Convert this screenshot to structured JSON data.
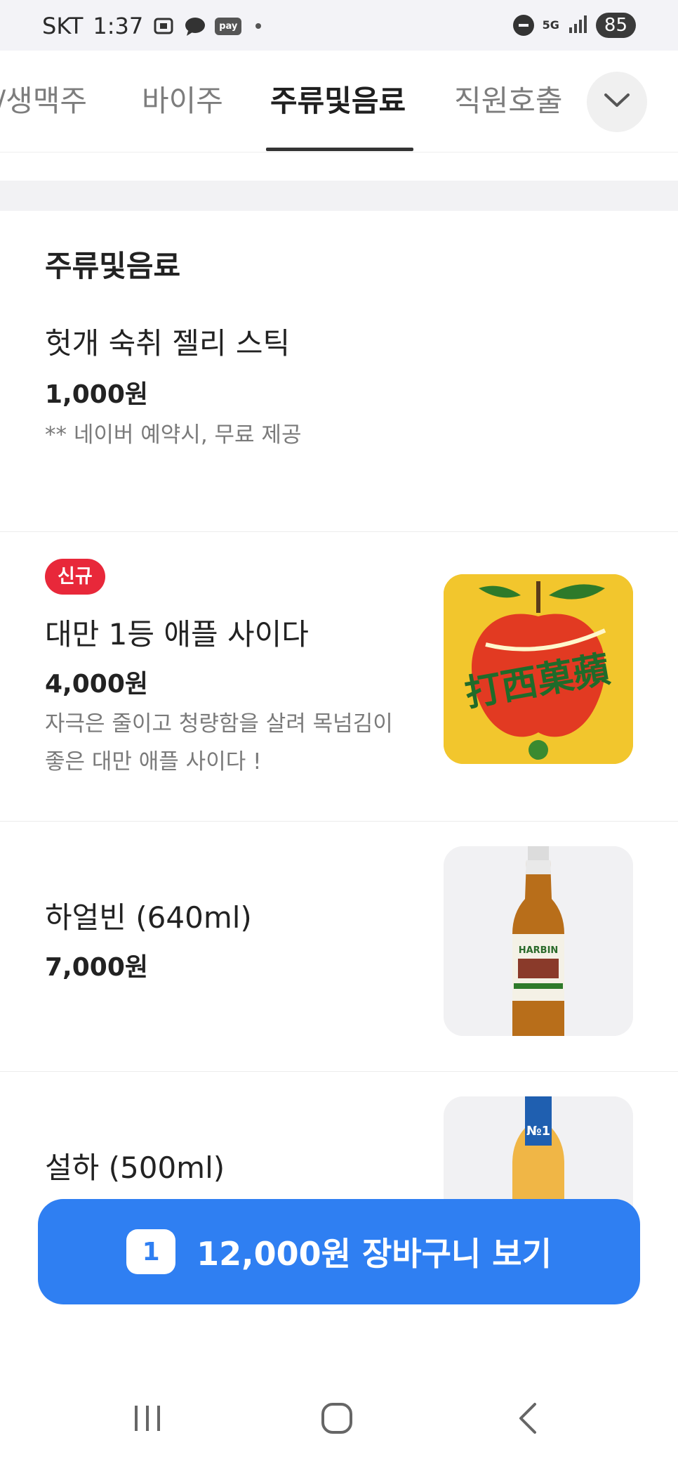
{
  "status_bar": {
    "carrier": "SKT",
    "time": "1:37",
    "pay_label": "pay",
    "network": "5G",
    "battery": "85"
  },
  "tabs": [
    {
      "label": "/생맥주",
      "active": false
    },
    {
      "label": "바이주",
      "active": false
    },
    {
      "label": "주류및음료",
      "active": true
    },
    {
      "label": "직원호출",
      "active": false
    }
  ],
  "section": {
    "title": "주류및음료"
  },
  "items": [
    {
      "name": "헛개 숙취 젤리 스틱",
      "price": "1,000원",
      "description": "** 네이버 예약시, 무료 제공"
    },
    {
      "badge": "신규",
      "name": "대만 1등 애플 사이다",
      "price": "4,000원",
      "description_line1": "자극은 줄이고 청량함을 살려 목넘김이",
      "description_line2": "좋은 대만 애플 사이다 !",
      "image_text": "打西菓蘋"
    },
    {
      "name": "하얼빈 (640ml)",
      "price": "7,000원",
      "image_text": "HARBIN"
    },
    {
      "name": "설하 (500ml)",
      "image_text": "№1"
    }
  ],
  "cart": {
    "count": "1",
    "label": "12,000원 장바구니 보기"
  },
  "colors": {
    "accent": "#2f7ff2",
    "badge": "#e8283a"
  }
}
